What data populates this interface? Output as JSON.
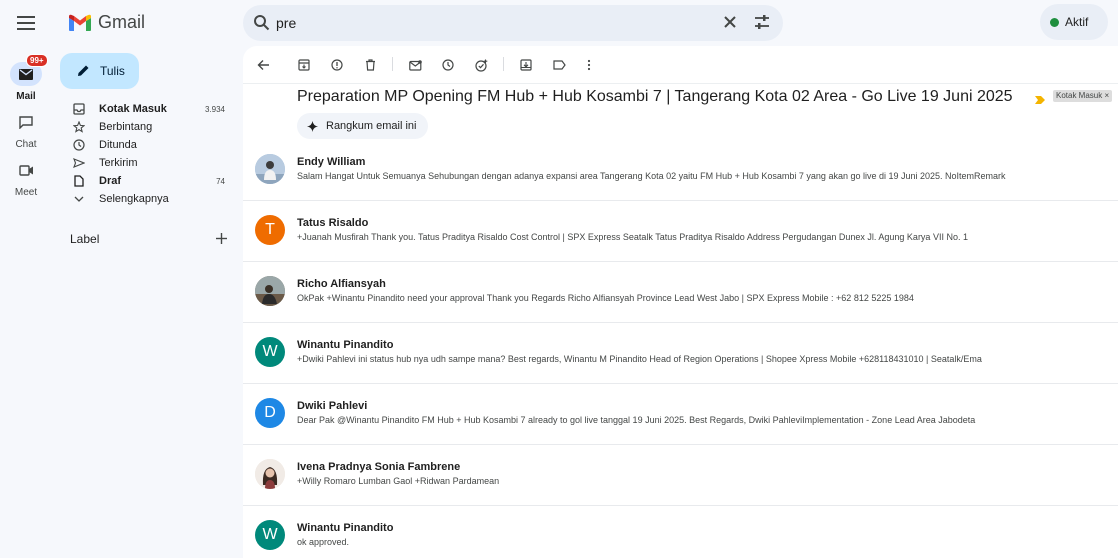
{
  "app": {
    "name": "Gmail"
  },
  "search": {
    "value": "pre"
  },
  "status": {
    "label": "Aktif",
    "color": "#1e8e3e"
  },
  "rail": {
    "items": [
      {
        "label": "Mail",
        "icon": "mail-icon",
        "badge": "99+",
        "active": true
      },
      {
        "label": "Chat",
        "icon": "chat-icon"
      },
      {
        "label": "Meet",
        "icon": "video-icon"
      }
    ]
  },
  "compose": {
    "label": "Tulis"
  },
  "nav": {
    "items": [
      {
        "label": "Kotak Masuk",
        "icon": "inbox-icon",
        "count": "3.934",
        "bold": true
      },
      {
        "label": "Berbintang",
        "icon": "star-icon"
      },
      {
        "label": "Ditunda",
        "icon": "clock-icon"
      },
      {
        "label": "Terkirim",
        "icon": "send-icon"
      },
      {
        "label": "Draf",
        "icon": "draft-icon",
        "count": "74",
        "bold": true
      },
      {
        "label": "Selengkapnya",
        "icon": "chevron-down-icon"
      }
    ]
  },
  "labels": {
    "title": "Label"
  },
  "thread": {
    "subject": "Preparation MP Opening FM Hub + Hub Kosambi 7 | Tangerang Kota 02 Area - Go Live 19 Juni 2025",
    "label_chip": "Kotak Masuk ×",
    "summarize_label": "Rangkum email ini",
    "messages": [
      {
        "sender": "Endy William",
        "snippet": "Salam Hangat Untuk Semuanya Sehubungan dengan adanya expansi area Tangerang Kota 02 yaitu FM Hub + Hub Kosambi 7 yang akan go live di 19 Juni 2025. NoItemRemark",
        "avatar": "photo",
        "avatar_color": "#6f8fb0"
      },
      {
        "sender": "Tatus Risaldo",
        "snippet": "+Juanah Musfirah Thank you. Tatus Praditya Risaldo Cost Control | SPX Express Seatalk Tatus Praditya Risaldo Address Pergudangan Dunex Jl. Agung Karya VII No. 1",
        "avatar": "T",
        "avatar_color": "#ef6c00"
      },
      {
        "sender": "Richo Alfiansyah",
        "snippet": "OkPak +Winantu Pinandito need your approval Thank you Regards Richo Alfiansyah Province Lead West Jabo | SPX Express Mobile : +62 812 5225 1984",
        "avatar": "photo",
        "avatar_color": "#8a7d6a"
      },
      {
        "sender": "Winantu Pinandito",
        "snippet": "+Dwiki Pahlevi ini status hub nya udh sampe mana? Best regards, Winantu M Pinandito Head of Region Operations | Shopee Xpress Mobile +628118431010 | Seatalk/Ema",
        "avatar": "W",
        "avatar_color": "#00897b"
      },
      {
        "sender": "Dwiki Pahlevi",
        "snippet": "Dear Pak @Winantu Pinandito FM Hub + Hub Kosambi 7 already to gol live tanggal 19 Juni 2025. Best Regards, Dwiki PahleviImplementation - Zone Lead Area Jabodeta",
        "avatar": "D",
        "avatar_color": "#1e88e5"
      },
      {
        "sender": "Ivena Pradnya Sonia Fambrene",
        "snippet": "+Willy Romaro Lumban Gaol +Ridwan Pardamean",
        "avatar": "photo",
        "avatar_color": "#e9ddd6"
      },
      {
        "sender": "Winantu Pinandito",
        "snippet": "ok approved.",
        "avatar": "W",
        "avatar_color": "#00897b"
      }
    ]
  }
}
